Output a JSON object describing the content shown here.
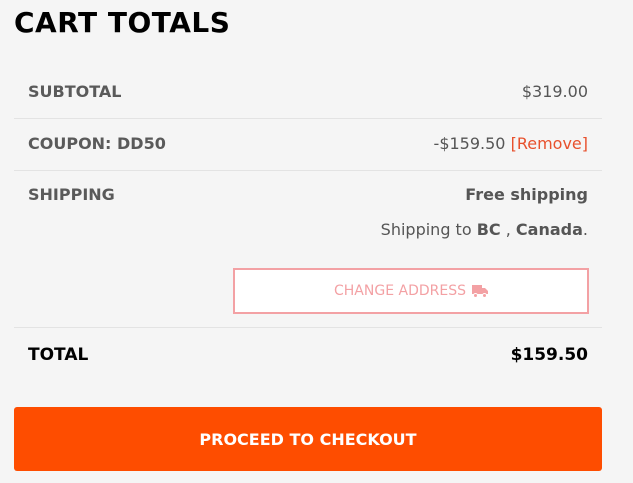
{
  "title": "CART TOTALS",
  "subtotal": {
    "label": "SUBTOTAL",
    "value": "$319.00"
  },
  "coupon": {
    "label": "COUPON: DD50",
    "value": "-$159.50",
    "remove_label": "[Remove]"
  },
  "shipping": {
    "label": "SHIPPING",
    "method": "Free shipping",
    "destination_prefix": "Shipping to",
    "province": "BC",
    "country": "Canada",
    "change_address_label": "CHANGE ADDRESS",
    "change_address_icon": "truck-icon"
  },
  "total": {
    "label": "TOTAL",
    "value": "$159.50"
  },
  "checkout_label": "PROCEED TO CHECKOUT",
  "colors": {
    "accent": "#fe4d00",
    "remove_link": "#e8512d",
    "change_address_border": "#f3a1a4"
  }
}
